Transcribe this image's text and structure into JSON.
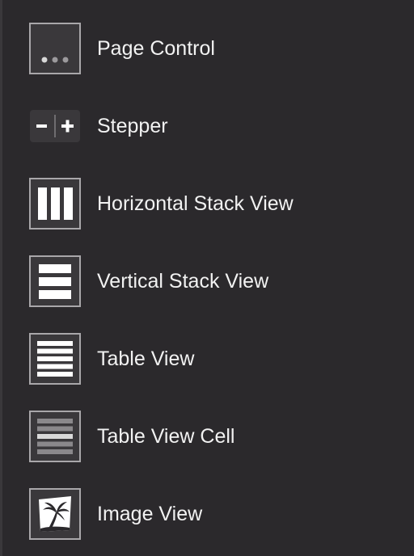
{
  "library": {
    "items": [
      {
        "label": "Page Control",
        "icon": "page-control-icon"
      },
      {
        "label": "Stepper",
        "icon": "stepper-icon"
      },
      {
        "label": "Horizontal Stack View",
        "icon": "horizontal-stack-view-icon"
      },
      {
        "label": "Vertical Stack View",
        "icon": "vertical-stack-view-icon"
      },
      {
        "label": "Table View",
        "icon": "table-view-icon"
      },
      {
        "label": "Table View Cell",
        "icon": "table-view-cell-icon"
      },
      {
        "label": "Image View",
        "icon": "image-view-icon"
      }
    ]
  },
  "colors": {
    "background": "#2b292c",
    "icon_border": "#a9a7aa",
    "icon_fill": "#3a383b",
    "text": "#f2f2f2"
  }
}
